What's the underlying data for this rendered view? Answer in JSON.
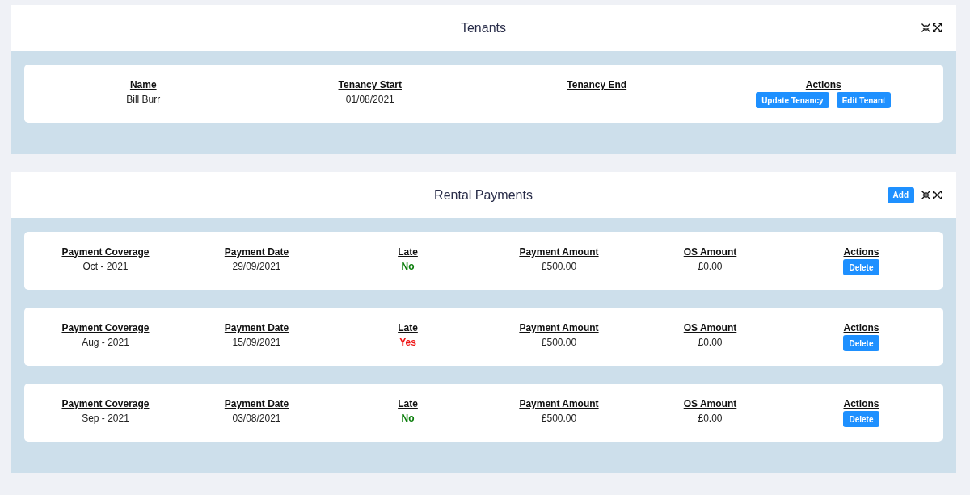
{
  "panels": [
    {
      "title": "Tenants",
      "cards": [
        {
          "fields": [
            {
              "kind": "text",
              "label": "Name",
              "value": "Bill Burr"
            },
            {
              "kind": "text",
              "label": "Tenancy Start",
              "value": "01/08/2021"
            },
            {
              "kind": "text",
              "label": "Tenancy End"
            },
            {
              "kind": "actions",
              "label": "Actions",
              "buttons": [
                "Update Tenancy",
                "Edit Tenant"
              ]
            }
          ]
        }
      ]
    },
    {
      "title": "Rental Payments",
      "header_buttons": [
        "Add"
      ],
      "cards": [
        {
          "fields": [
            {
              "kind": "text",
              "label": "Payment Coverage",
              "value": "Oct - 2021"
            },
            {
              "kind": "text",
              "label": "Payment Date",
              "value": "29/09/2021"
            },
            {
              "kind": "status",
              "label": "Late",
              "value": "No",
              "color": "#0a7d0a"
            },
            {
              "kind": "text",
              "label": "Payment Amount",
              "value": "£500.00"
            },
            {
              "kind": "text",
              "label": "OS Amount",
              "value": "£0.00"
            },
            {
              "kind": "actions",
              "label": "Actions",
              "buttons": [
                "Delete"
              ]
            }
          ]
        },
        {
          "fields": [
            {
              "kind": "text",
              "label": "Payment Coverage",
              "value": "Aug - 2021"
            },
            {
              "kind": "text",
              "label": "Payment Date",
              "value": "15/09/2021"
            },
            {
              "kind": "status",
              "label": "Late",
              "value": "Yes",
              "color": "#f01414"
            },
            {
              "kind": "text",
              "label": "Payment Amount",
              "value": "£500.00"
            },
            {
              "kind": "text",
              "label": "OS Amount",
              "value": "£0.00"
            },
            {
              "kind": "actions",
              "label": "Actions",
              "buttons": [
                "Delete"
              ]
            }
          ]
        },
        {
          "fields": [
            {
              "kind": "text",
              "label": "Payment Coverage",
              "value": "Sep - 2021"
            },
            {
              "kind": "text",
              "label": "Payment Date",
              "value": "03/08/2021"
            },
            {
              "kind": "status",
              "label": "Late",
              "value": "No",
              "color": "#0a7d0a"
            },
            {
              "kind": "text",
              "label": "Payment Amount",
              "value": "£500.00"
            },
            {
              "kind": "text",
              "label": "OS Amount",
              "value": "£0.00"
            },
            {
              "kind": "actions",
              "label": "Actions",
              "buttons": [
                "Delete"
              ]
            }
          ]
        }
      ]
    }
  ]
}
